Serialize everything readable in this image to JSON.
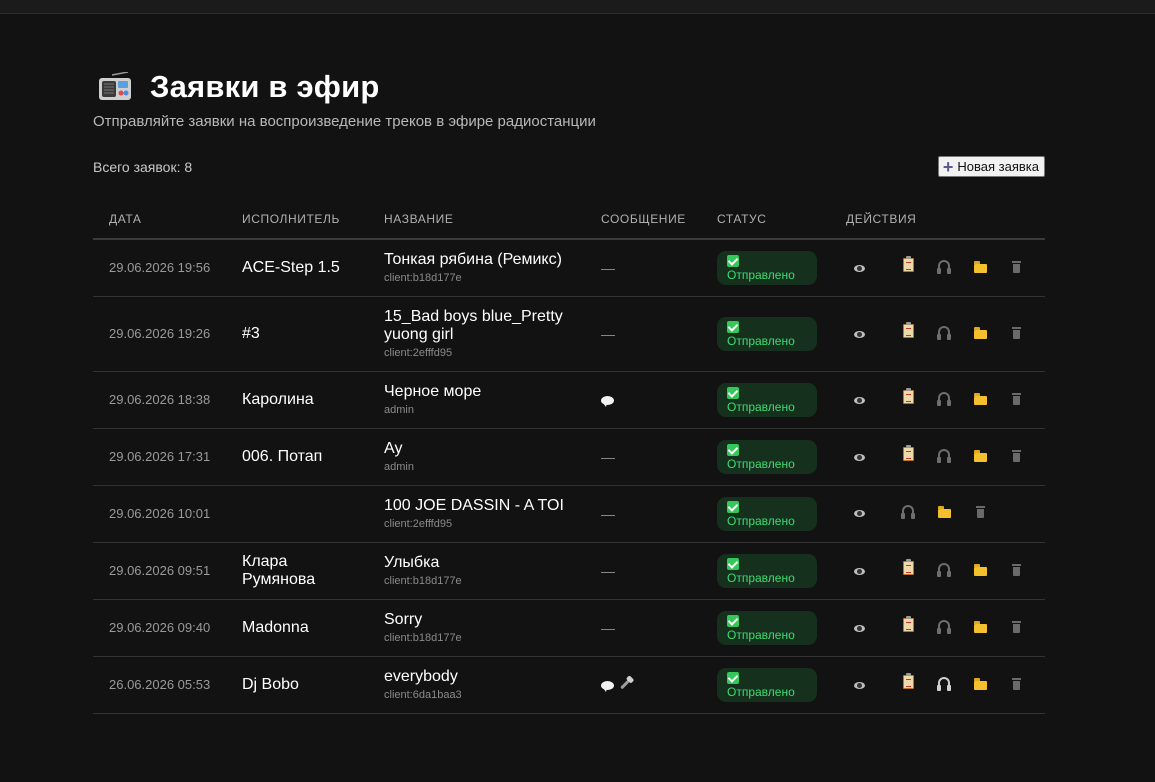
{
  "page": {
    "title": "Заявки в эфир",
    "subtitle": "Отправляйте заявки на воспроизведение треков в эфире радиостанции",
    "total_label": "Всего заявок: 8",
    "new_button": "Новая заявка"
  },
  "icons": {
    "header": "radio-icon",
    "new_button": "plus-icon",
    "view": "eye-icon",
    "copy": "clipboard-icon",
    "listen": "headphones-icon",
    "open_folder": "folder-icon",
    "delete": "trash-icon",
    "message": "speech-bubble-icon",
    "voice": "microphone-icon",
    "status": "check-icon"
  },
  "colors": {
    "background": "#121212",
    "status_bg": "#16301e",
    "status_text": "#3ddc72",
    "check": "#34c759",
    "folder": "#f5c02e"
  },
  "table": {
    "columns": [
      "ДАТА",
      "ИСПОЛНИТЕЛЬ",
      "НАЗВАНИЕ",
      "СООБЩЕНИЕ",
      "СТАТУС",
      "ДЕЙСТВИЯ"
    ],
    "rows": [
      {
        "date": "29.06.2026 19:56",
        "artist": "ACE-Step 1.5",
        "title": "Тонкая рябина (Ремикс)",
        "source": "client:b18d177e",
        "message": "—",
        "status": "Отправлено"
      },
      {
        "date": "29.06.2026 19:26",
        "artist": "#3",
        "title": "15_Bad boys blue_Pretty yuong girl",
        "source": "client:2efffd95",
        "message": "—",
        "status": "Отправлено"
      },
      {
        "date": "29.06.2026 18:38",
        "artist": "Каролина",
        "title": "Черное море",
        "source": "admin",
        "message": "",
        "status": "Отправлено"
      },
      {
        "date": "29.06.2026 17:31",
        "artist": "006. Потап",
        "title": "Ау",
        "source": "admin",
        "message": "—",
        "status": "Отправлено"
      },
      {
        "date": "29.06.2026 10:01",
        "artist": "",
        "title": "100 JOE DASSIN - A TOI",
        "source": "client:2efffd95",
        "message": "—",
        "status": "Отправлено"
      },
      {
        "date": "29.06.2026 09:51",
        "artist": "Клара Румянова",
        "title": "Улыбка",
        "source": "client:b18d177e",
        "message": "—",
        "status": "Отправлено"
      },
      {
        "date": "29.06.2026 09:40",
        "artist": "Madonna",
        "title": "Sorry",
        "source": "client:b18d177e",
        "message": "—",
        "status": "Отправлено"
      },
      {
        "date": "26.06.2026 05:53",
        "artist": "Dj Bobo",
        "title": "everybody",
        "source": "client:6da1baa3",
        "message": "",
        "status": "Отправлено"
      }
    ]
  }
}
